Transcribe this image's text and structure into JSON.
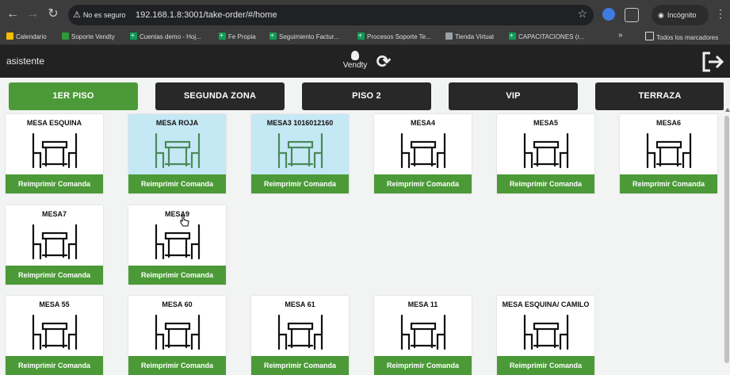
{
  "browser": {
    "security_label": "No es seguro",
    "url": "192.168.1.8:3001/take-order/#/home",
    "incognito_label": "Incógnito"
  },
  "bookmarks": [
    {
      "label": "Calendario",
      "icon": "calendar-icon"
    },
    {
      "label": "Soporte Vendty",
      "icon": "vendty-icon"
    },
    {
      "label": "Cuentas demo - Hoj...",
      "icon": "sheets-icon"
    },
    {
      "label": "Fe Propia",
      "icon": "sheets-icon"
    },
    {
      "label": "Seguimiento Factur...",
      "icon": "sheets-icon"
    },
    {
      "label": "Procesos Soporte Te...",
      "icon": "sheets-icon"
    },
    {
      "label": "Tienda Virtual",
      "icon": "globe-icon"
    },
    {
      "label": "CAPACITACIONES (r...",
      "icon": "sheets-icon"
    }
  ],
  "bookmarks_all_label": "Todos los marcadores",
  "header": {
    "role": "asistente",
    "logo_text": "Vendty"
  },
  "zones": [
    {
      "label": "1ER PISO",
      "active": true
    },
    {
      "label": "SEGUNDA ZONA",
      "active": false
    },
    {
      "label": "PISO 2",
      "active": false
    },
    {
      "label": "VIP",
      "active": false
    },
    {
      "label": "TERRAZA",
      "active": false
    }
  ],
  "reprint_label": "Reimprimir Comanda",
  "tables": [
    {
      "name": "MESA ESQUINA",
      "occupied": false
    },
    {
      "name": "MESA ROJA",
      "occupied": true
    },
    {
      "name": "MESA3 1016012160",
      "occupied": true
    },
    {
      "name": "MESA4",
      "occupied": false
    },
    {
      "name": "MESA5",
      "occupied": false
    },
    {
      "name": "MESA6",
      "occupied": false
    },
    {
      "name": "MESA7",
      "occupied": false
    },
    {
      "name": "MESA9",
      "occupied": false
    },
    {
      "name": "MESA 55",
      "occupied": false
    },
    {
      "name": "MESA 60",
      "occupied": false
    },
    {
      "name": "MESA 61",
      "occupied": false
    },
    {
      "name": "MESA 11",
      "occupied": false
    },
    {
      "name": "MESA ESQUINA/ CAMILO",
      "occupied": false
    }
  ],
  "colors": {
    "accent_green": "#4b9a37",
    "occupied_blue": "#c5e8f5",
    "zone_dark": "#282828",
    "header_dark": "#222222"
  }
}
